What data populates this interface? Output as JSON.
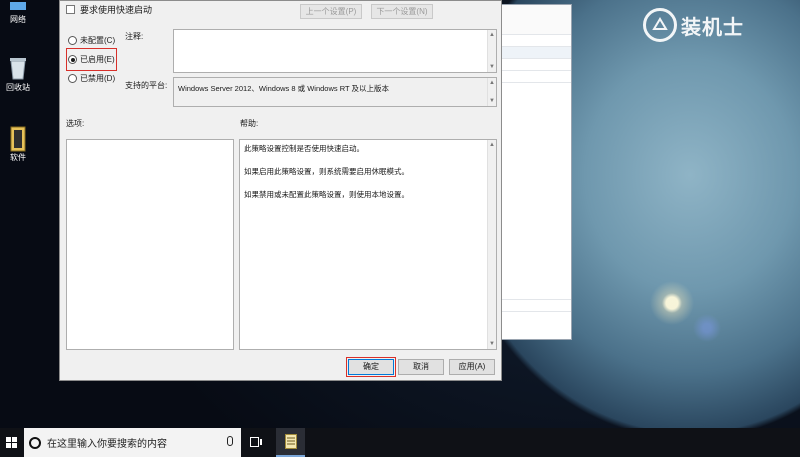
{
  "desktop": {
    "icons": [
      {
        "label": "网络"
      },
      {
        "label": "回收站"
      },
      {
        "label": "软件"
      }
    ],
    "brand": {
      "text": "装机士"
    }
  },
  "dialog": {
    "title": "要求使用快速启动",
    "prev_button": "上一个设置(P)",
    "next_button": "下一个设置(N)",
    "radios": [
      {
        "label": "未配置(C)",
        "checked": false
      },
      {
        "label": "已启用(E)",
        "checked": true
      },
      {
        "label": "已禁用(D)",
        "checked": false
      }
    ],
    "comment_label": "注释:",
    "comment_value": "",
    "supported_label": "支持的平台:",
    "supported_value": "Windows Server 2012、Windows 8 或 Windows RT 及以上版本",
    "options_label": "选项:",
    "help_label": "帮助:",
    "help_lines": [
      "此策略设置控制是否使用快速启动。",
      "如果启用此策略设置，则系统需要启用休眠模式。",
      "如果禁用或未配置此策略设置，则使用本地设置。"
    ],
    "buttons": {
      "ok": "确定",
      "cancel": "取消",
      "apply": "应用(A)"
    }
  },
  "taskbar": {
    "search_placeholder": "在这里输入你要搜索的内容"
  }
}
